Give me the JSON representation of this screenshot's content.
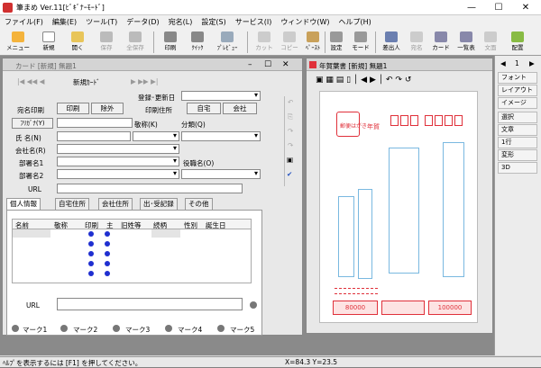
{
  "app": {
    "title": "筆まめ Ver.11[ﾋﾞｷﾞﾅｰﾓｰﾄﾞ]",
    "minimize": "—",
    "maximize": "☐",
    "close": "✕"
  },
  "menu": [
    "ファイル(F)",
    "編集(E)",
    "ツール(T)",
    "データ(D)",
    "宛名(L)",
    "設定(S)",
    "サービス(I)",
    "ウィンドウ(W)",
    "ヘルプ(H)"
  ],
  "toolbar": {
    "menu": "メニュー",
    "new": "新規",
    "open": "開く",
    "save": "保存",
    "saveall": "全保存",
    "print": "印刷",
    "quick": "ｸｲｯｸ",
    "preview": "ﾌﾟﾚﾋﾞｭｰ",
    "cut": "カット",
    "copy": "コピー",
    "paste": "ﾍﾟｰｽﾄ",
    "settings": "設定",
    "mode": "モード",
    "sender": "差出人",
    "atena": "宛名",
    "card": "カード",
    "list": "一覧表",
    "text": "文面",
    "layout": "配置"
  },
  "card_window": {
    "title": "カード [新規] 無題1",
    "nav_label": "新規ｶｰﾄﾞ",
    "reg_label": "登録･更新日",
    "atena_print": "宛名印刷",
    "print_btn": "印刷",
    "exclude_btn": "除外",
    "print_addr": "印刷住所",
    "home_btn": "自宅",
    "company_btn": "会社",
    "furigana": "ﾌﾘｶﾞﾅ(Y)",
    "title_label": "敬称(K)",
    "category": "分類(Q)",
    "name": "氏 名(N)",
    "company": "会社名(R)",
    "dept1": "部署名1",
    "position": "役職名(O)",
    "dept2": "部署名2",
    "url": "URL",
    "tabs": [
      "個人情報",
      "自宅住所",
      "会社住所",
      "出･受記録",
      "その他"
    ],
    "table_headers": [
      "名前",
      "敬称",
      "印刷",
      "主",
      "旧姓等",
      "続柄",
      "性別",
      "誕生日"
    ],
    "url2": "URL",
    "marks": [
      "マーク1",
      "マーク2",
      "マーク3",
      "マーク4",
      "マーク5"
    ]
  },
  "preview_window": {
    "title": "年賀葉書 [新規] 無題1",
    "sender_label": "年賀",
    "stamp": "郵便はがき",
    "post_amount": "80000",
    "right_amount": "100000"
  },
  "right_panel": {
    "font": "フォント",
    "layout": "レイアウト",
    "image": "イメージ",
    "select": "選択",
    "text": "文章",
    "line": "1行",
    "shape": "変形",
    "3d": "3D",
    "page": "1"
  },
  "status": {
    "help": "ﾍﾙﾌﾟを表示するには [F1] を押してください。",
    "coords": "X=84.3 Y=23.5"
  },
  "colors": {
    "accent": "#e0303a",
    "blue": "#1f2fd0",
    "frame": "#79b8e0"
  }
}
